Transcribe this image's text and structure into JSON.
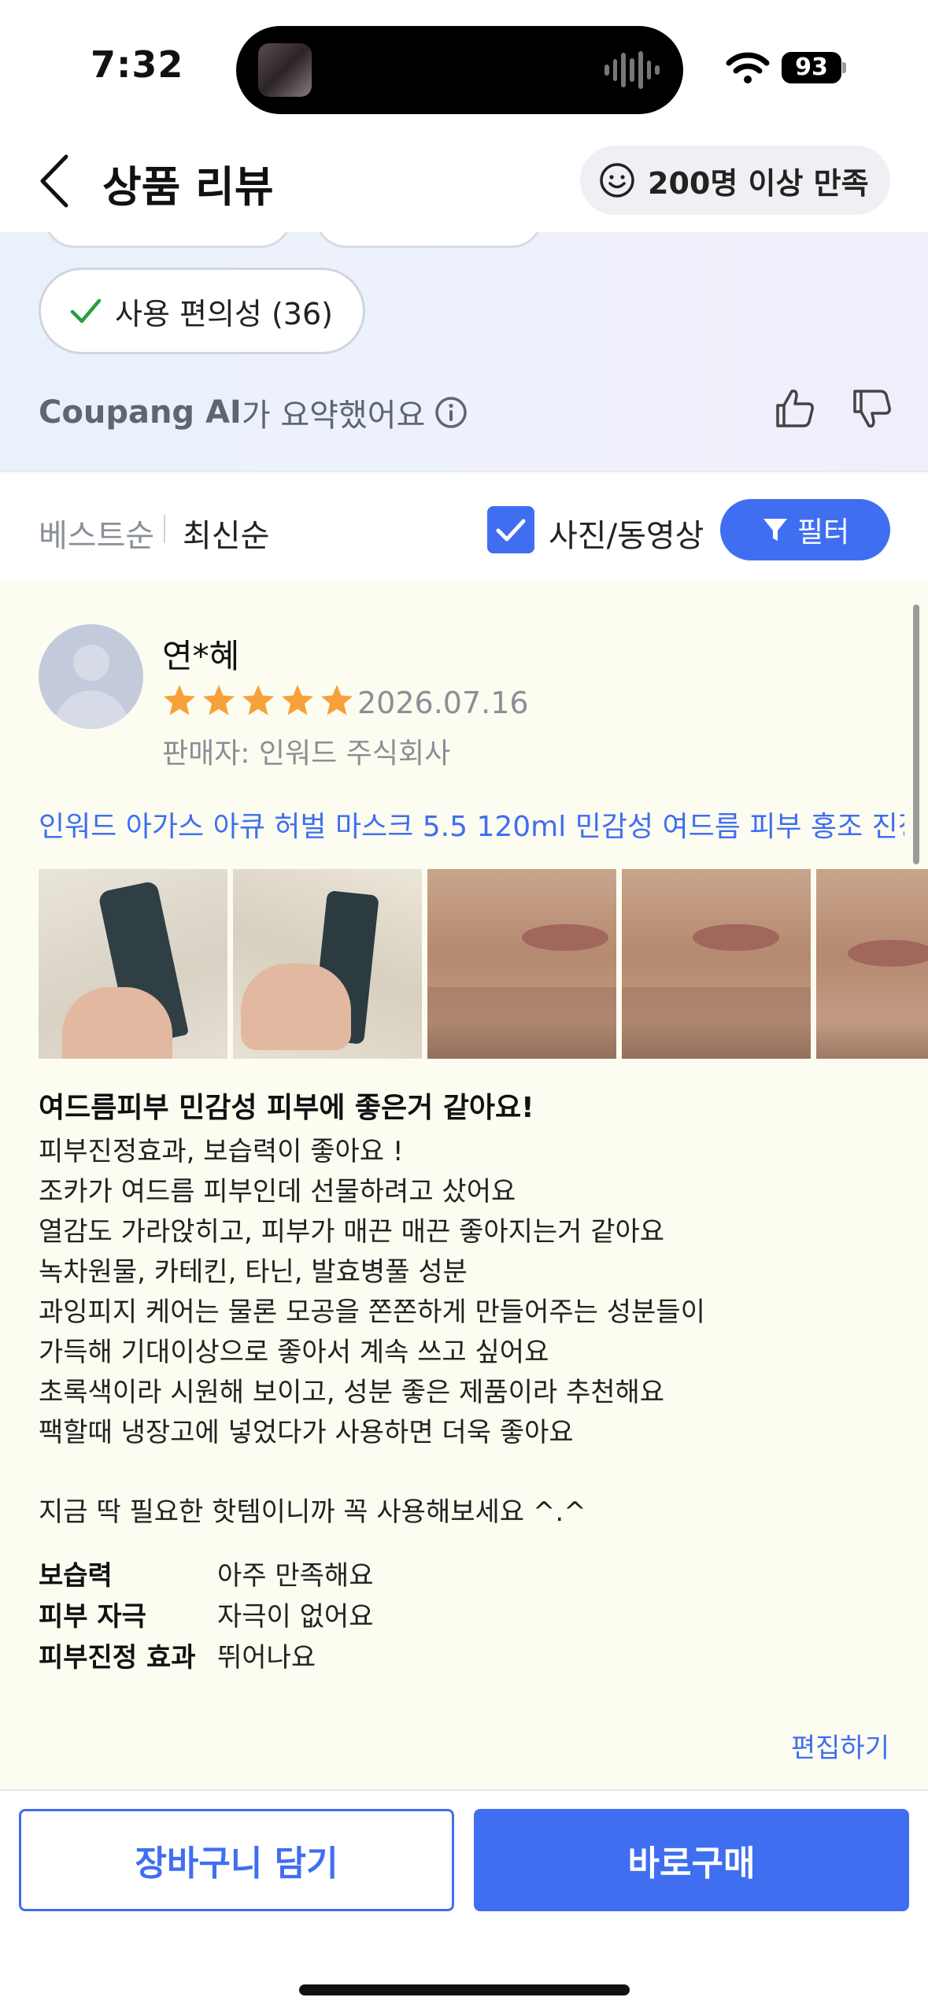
{
  "status_bar": {
    "time": "7:32",
    "battery": "93"
  },
  "header": {
    "title": "상품 리뷰",
    "badge": "200명 이상 만족"
  },
  "ai_summary": {
    "chip_label": "사용 편의성 (36)",
    "credit_brand": "Coupang AI",
    "credit_text": "가 요약했어요"
  },
  "sort": {
    "best": "베스트순",
    "latest": "최신순",
    "photo_filter_label": "사진/동영상",
    "photo_filter_checked": true,
    "filter_button": "필터"
  },
  "review": {
    "name": "연*혜",
    "rating": 5,
    "date": "2026.07.16",
    "seller": "판매자: 인워드 주식회사",
    "product": "인워드 아가스 아큐 허벌 마스크 5.5 120ml 민감성 여드름 피부 홍조 진정...",
    "title": "여드름피부 민감성 피부에 좋은거 같아요!",
    "body": [
      "피부진정효과, 보습력이 좋아요 !",
      "조카가 여드름 피부인데 선물하려고 샀어요",
      "열감도 가라앉히고, 피부가 매끈 매끈 좋아지는거 같아요",
      "녹차원물, 카테킨, 타닌, 발효병풀 성분",
      "과잉피지 케어는 물론 모공을 쫀쫀하게 만들어주는 성분들이",
      "가득해 기대이상으로 좋아서 계속 쓰고 싶어요",
      "초록색이라 시원해 보이고, 성분 좋은 제품이라 추천해요",
      "팩할때 냉장고에 넣었다가 사용하면 더욱 좋아요",
      "",
      "지금 딱 필요한 핫템이니까 꼭 사용해보세요 ^.^"
    ],
    "ratings": [
      {
        "label": "보습력",
        "value": "아주 만족해요"
      },
      {
        "label": "피부 자극",
        "value": "자극이 없어요"
      },
      {
        "label": "피부진정 효과",
        "value": "뛰어나요"
      }
    ],
    "edit": "편집하기"
  },
  "actions": {
    "cart": "장바구니 담기",
    "buy": "바로구매"
  },
  "colors": {
    "accent": "#3f6ff0",
    "star": "#f7a13a",
    "review_bg": "#fdfcf1"
  }
}
